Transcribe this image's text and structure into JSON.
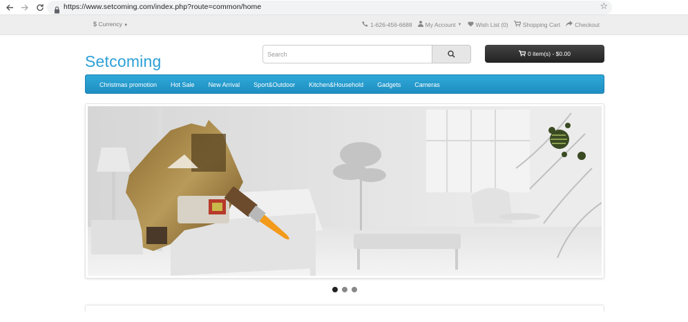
{
  "browser": {
    "url": "https://www.setcoming.com/index.php?route=common/home"
  },
  "topbar": {
    "currency_symbol": "$",
    "currency_label": "Currency",
    "phone": "1-626-456-6688",
    "account": "My Account",
    "wishlist": "Wish List (0)",
    "cart": "Shopping Cart",
    "checkout": "Checkout"
  },
  "header": {
    "logo": "Setcoming",
    "search_placeholder": "Search",
    "cart_button": "0 item(s) - $0.00"
  },
  "menu": {
    "items": [
      "Christmas promotion",
      "Hot Sale",
      "New Arrival",
      "Sport&Outdoor",
      "Kitchen&Household",
      "Gadgets",
      "Cameras"
    ]
  },
  "slideshow": {
    "dots": 3,
    "active_dot": 0
  },
  "colors": {
    "brand_blue": "#2c9fd6",
    "menu_blue": "#2398cc",
    "cart_dark": "#2b2b2b"
  }
}
